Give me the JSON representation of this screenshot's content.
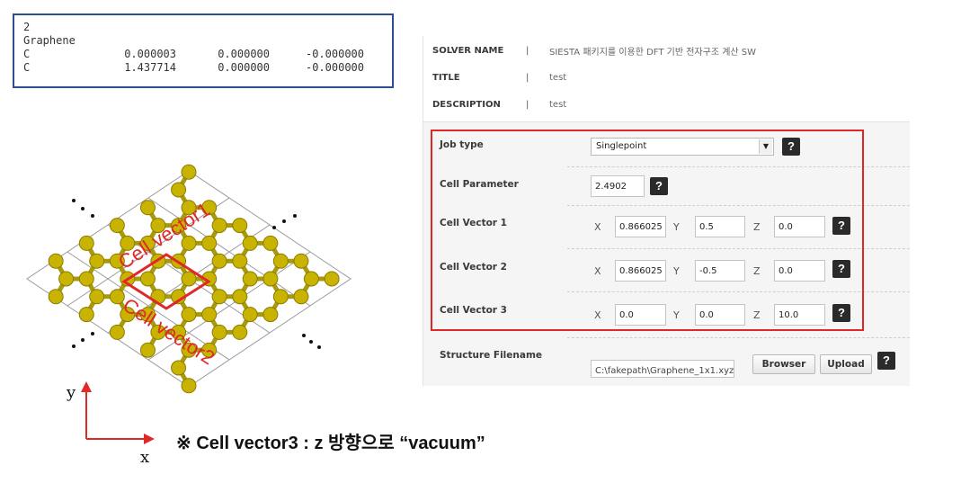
{
  "xyz": {
    "count": "2",
    "name": "Graphene",
    "atoms": [
      {
        "el": "C",
        "x": "0.000003",
        "y": "0.000000",
        "z": "-0.000000"
      },
      {
        "el": "C",
        "x": "1.437714",
        "y": "0.000000",
        "z": "-0.000000"
      }
    ]
  },
  "figure": {
    "label1": "Cell vector1",
    "label2": "Cell vector2",
    "axis_x": "x",
    "axis_y": "y"
  },
  "note": "※ Cell vector3 : z 방향으로  “vacuum”",
  "panel": {
    "solver_label": "SOLVER NAME",
    "solver_value": "SIESTA 패키지를 이용한 DFT 기반 전자구조 계산 SW",
    "title_label": "TITLE",
    "title_value": "test",
    "desc_label": "DESCRIPTION",
    "desc_value": "test",
    "separator": "|",
    "job_type_label": "Job type",
    "job_type_value": "Singlepoint",
    "cell_param_label": "Cell Parameter",
    "cell_param_value": "2.4902",
    "help": "?",
    "cv1_label": "Cell Vector 1",
    "cv2_label": "Cell Vector 2",
    "cv3_label": "Cell Vector 3",
    "x": "X",
    "y": "Y",
    "z": "Z",
    "cv1": {
      "x": "0.866025",
      "y": "0.5",
      "z": "0.0"
    },
    "cv2": {
      "x": "0.866025",
      "y": "-0.5",
      "z": "0.0"
    },
    "cv3": {
      "x": "0.0",
      "y": "0.0",
      "z": "10.0"
    },
    "structure_label": "Structure Filename",
    "structure_value": "C:\\fakepath\\Graphene_1x1.xyz",
    "browser_btn": "Browser",
    "upload_btn": "Upload"
  },
  "colors": {
    "frame_blue": "#2c4f8f",
    "highlight_red": "#e12828",
    "atom": "#c8b400",
    "bond": "#a89a10"
  }
}
